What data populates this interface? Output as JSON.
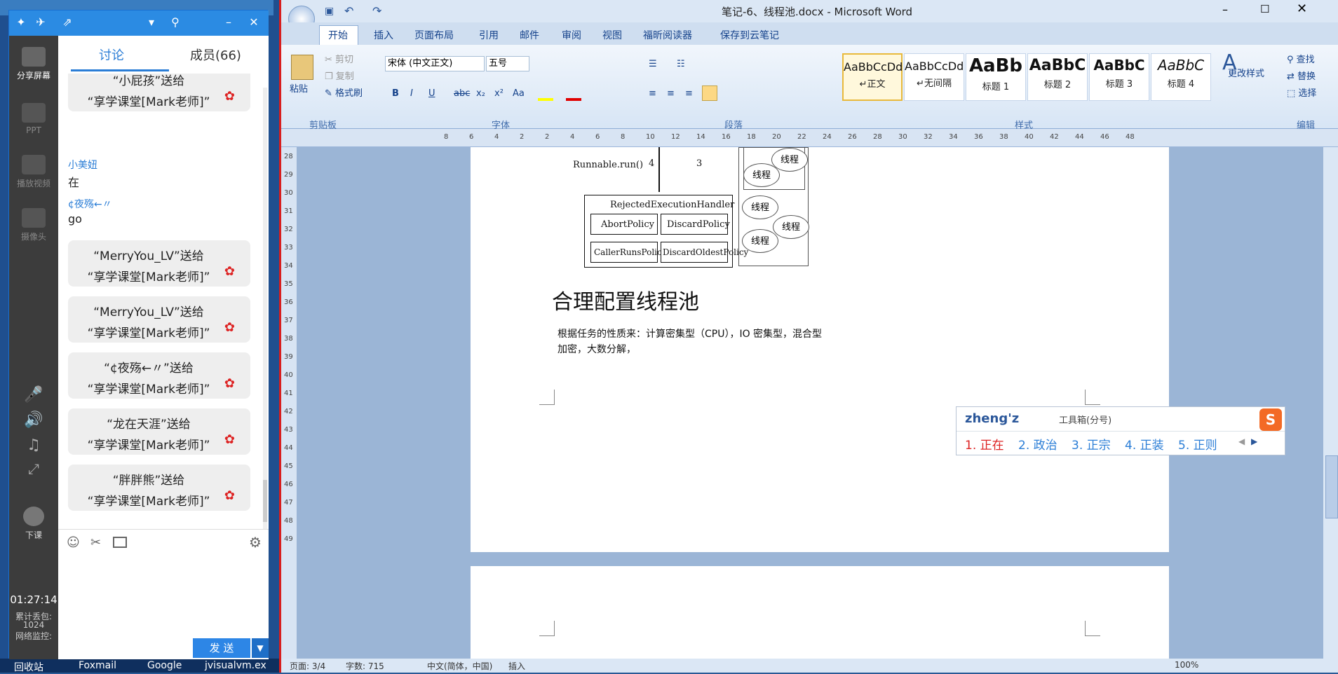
{
  "chat": {
    "tabs": [
      "讨论",
      "成员(66)"
    ],
    "sidebar": {
      "share": "分享屏幕",
      "ppt": "PPT",
      "video": "播放视频",
      "camera": "摄像头",
      "end": "下课"
    },
    "time": "01:27:14",
    "stats": {
      "label1": "累计丢包:",
      "value1": "1024",
      "label2": "网络监控:"
    },
    "messages": [
      {
        "type": "gift",
        "line1": "“小屁孩”送给",
        "line2": "“享学课堂[Mark老师]”"
      },
      {
        "type": "text",
        "user": "小美妞",
        "text": "在"
      },
      {
        "type": "text",
        "user": "¢夜殇←〃",
        "text": "go"
      },
      {
        "type": "gift",
        "line1": "“MerryYou_LV”送给",
        "line2": "“享学课堂[Mark老师]”"
      },
      {
        "type": "gift",
        "line1": "“MerryYou_LV”送给",
        "line2": "“享学课堂[Mark老师]”"
      },
      {
        "type": "gift",
        "line1": "“¢夜殇←〃”送给",
        "line2": "“享学课堂[Mark老师]”"
      },
      {
        "type": "gift",
        "line1": "“龙在天涯”送给",
        "line2": "“享学课堂[Mark老师]”"
      },
      {
        "type": "gift",
        "line1": "“胖胖熊”送给",
        "line2": "“享学课堂[Mark老师]”"
      }
    ],
    "send": "发 送"
  },
  "taskbar": [
    "回收站",
    "Foxmail",
    "Google",
    "jvisualvm.ex"
  ],
  "word": {
    "title": "笔记-6、线程池.docx - Microsoft Word",
    "tabs": [
      "开始",
      "插入",
      "页面布局",
      "引用",
      "邮件",
      "审阅",
      "视图",
      "福昕阅读器",
      "保存到云笔记"
    ],
    "clipboard": {
      "paste": "粘贴",
      "cut": "剪切",
      "copy": "复制",
      "format": "格式刷",
      "group": "剪贴板"
    },
    "font": {
      "name": "宋体 (中文正文)",
      "size": "五号",
      "group": "字体"
    },
    "paragraph_group": "段落",
    "styles": [
      {
        "preview": "AaBbCcDd",
        "name": "↵正文"
      },
      {
        "preview": "AaBbCcDd",
        "name": "↵无间隔"
      },
      {
        "preview": "AaBb",
        "name": "标题 1"
      },
      {
        "preview": "AaBbC",
        "name": "标题 2"
      },
      {
        "preview": "AaBbC",
        "name": "标题 3"
      },
      {
        "preview": "AaBbC",
        "name": "标题 4"
      }
    ],
    "styles_group": "样式",
    "change_style": "更改样式",
    "edit": {
      "find": "查找",
      "replace": "替换",
      "select": "选择",
      "group": "编辑"
    },
    "ruler": [
      "8",
      "6",
      "4",
      "2",
      "2",
      "4",
      "6",
      "8",
      "10",
      "12",
      "14",
      "16",
      "18",
      "20",
      "22",
      "24",
      "26",
      "28",
      "30",
      "32",
      "34",
      "36",
      "38",
      "40",
      "42",
      "44",
      "46",
      "48"
    ],
    "vruler": [
      "28",
      "29",
      "30",
      "31",
      "32",
      "33",
      "34",
      "35",
      "36",
      "37",
      "38",
      "39",
      "40",
      "41",
      "42",
      "43",
      "44",
      "45",
      "46",
      "47",
      "48",
      "49"
    ],
    "diagram": {
      "run": "Runnable.run()",
      "n4": "4",
      "n3": "3",
      "handler": "RejectedExecutionHandler",
      "policies": [
        "AbortPolicy",
        "DiscardPolicy",
        "CallerRunsPolicy",
        "DiscardOldestPolicy"
      ],
      "thread": "线程"
    },
    "heading": "合理配置线程池",
    "para1": "根据任务的性质来：计算密集型（CPU），IO 密集型，混合型",
    "para2": "加密，大数分解，",
    "ime": {
      "input": "zheng'z",
      "tool": "工具箱(分号)",
      "candidates": [
        "1. 正在",
        "2. 政治",
        "3. 正宗",
        "4. 正装",
        "5. 正则"
      ]
    },
    "status": {
      "page": "页面: 3/4",
      "words": "字数: 715",
      "lang": "中文(简体，中国)",
      "mode": "插入",
      "zoom": "100%"
    }
  }
}
